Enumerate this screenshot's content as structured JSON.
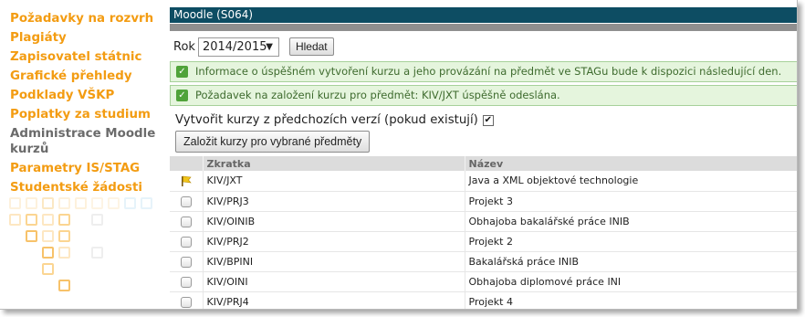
{
  "sidebar": {
    "items": [
      {
        "label": "Požadavky na rozvrh",
        "active": false
      },
      {
        "label": "Plagiáty",
        "active": false
      },
      {
        "label": "Zapisovatel státnic",
        "active": false
      },
      {
        "label": "Grafické přehledy",
        "active": false
      },
      {
        "label": "Podklady VŠKP",
        "active": false
      },
      {
        "label": "Poplatky za studium",
        "active": false
      },
      {
        "label": "Administrace Moodle kurzů",
        "active": true
      },
      {
        "label": "Parametry IS/STAG",
        "active": false
      },
      {
        "label": "Studentské žádosti",
        "active": false
      }
    ]
  },
  "panel": {
    "title": "Moodle (S064)"
  },
  "filter": {
    "year_label": "Rok",
    "year_value": "2014/2015",
    "search_button": "Hledat"
  },
  "messages": [
    "Informace o úspěšném vytvoření kurzu a jeho provázání na předmět ve STAGu bude k dispozici následující den.",
    "Požadavek na založení kurzu pro předmět: KIV/JXT úspěšně odeslána."
  ],
  "create": {
    "checkbox_label": "Vytvořit kurzy z předchozích verzí (pokud existují)",
    "checked": true,
    "button_label": "Založit kurzy pro vybrané předměty"
  },
  "table": {
    "headers": [
      "",
      "Zkratka",
      "Název"
    ],
    "rows": [
      {
        "marker": "flag-icon",
        "code": "KIV/JXT",
        "name": "Java a XML objektové technologie"
      },
      {
        "marker": "checkbox",
        "code": "KIV/PRJ3",
        "name": "Projekt 3"
      },
      {
        "marker": "checkbox",
        "code": "KIV/OINIB",
        "name": "Obhajoba bakalářské práce INIB"
      },
      {
        "marker": "checkbox",
        "code": "KIV/PRJ2",
        "name": "Projekt 2"
      },
      {
        "marker": "checkbox",
        "code": "KIV/BPINI",
        "name": "Bakalářská práce INIB"
      },
      {
        "marker": "checkbox",
        "code": "KIV/OINI",
        "name": "Obhajoba diplomové práce INI"
      },
      {
        "marker": "checkbox",
        "code": "KIV/PRJ4",
        "name": "Projekt 4"
      }
    ]
  },
  "colors": {
    "nav_link": "#f39c12",
    "nav_active": "#6b6b6b",
    "titlebar": "#0d4d63",
    "success_bg": "#e5f5dd",
    "success_text": "#3e6b2e"
  }
}
